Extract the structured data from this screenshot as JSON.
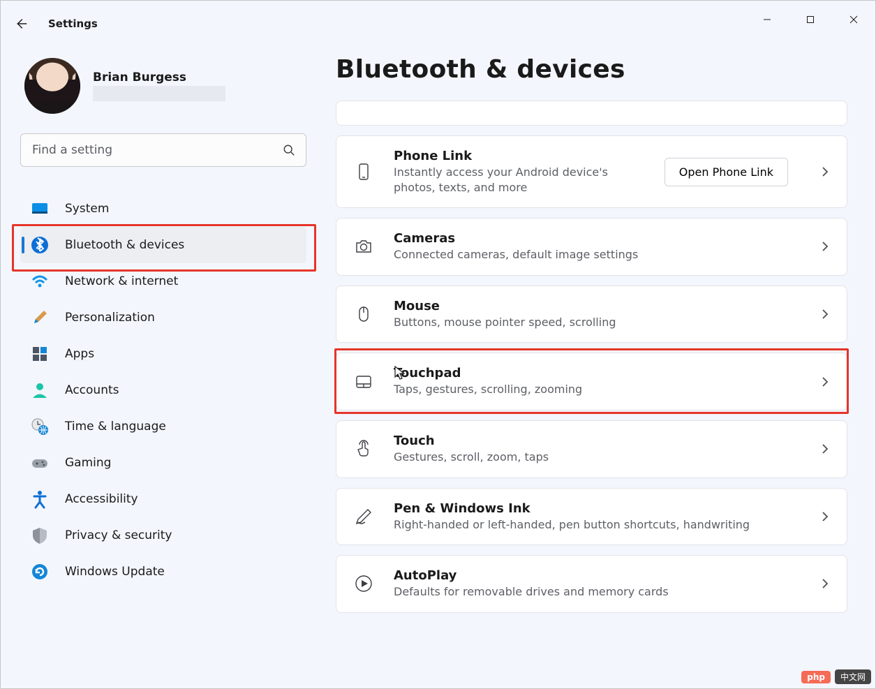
{
  "app": {
    "title": "Settings"
  },
  "profile": {
    "name": "Brian Burgess"
  },
  "search": {
    "placeholder": "Find a setting"
  },
  "sidebar": {
    "items": [
      {
        "label": "System"
      },
      {
        "label": "Bluetooth & devices"
      },
      {
        "label": "Network & internet"
      },
      {
        "label": "Personalization"
      },
      {
        "label": "Apps"
      },
      {
        "label": "Accounts"
      },
      {
        "label": "Time & language"
      },
      {
        "label": "Gaming"
      },
      {
        "label": "Accessibility"
      },
      {
        "label": "Privacy & security"
      },
      {
        "label": "Windows Update"
      }
    ],
    "selected_index": 1
  },
  "page": {
    "title": "Bluetooth & devices"
  },
  "cards": [
    {
      "title": "Phone Link",
      "desc": "Instantly access your Android device's photos, texts, and more",
      "button": "Open Phone Link"
    },
    {
      "title": "Cameras",
      "desc": "Connected cameras, default image settings"
    },
    {
      "title": "Mouse",
      "desc": "Buttons, mouse pointer speed, scrolling"
    },
    {
      "title": "Touchpad",
      "desc": "Taps, gestures, scrolling, zooming"
    },
    {
      "title": "Touch",
      "desc": "Gestures, scroll, zoom, taps"
    },
    {
      "title": "Pen & Windows Ink",
      "desc": "Right-handed or left-handed, pen button shortcuts, handwriting"
    },
    {
      "title": "AutoPlay",
      "desc": "Defaults for removable drives and memory cards"
    }
  ],
  "watermark": {
    "badge": "php",
    "text": "中文网"
  }
}
